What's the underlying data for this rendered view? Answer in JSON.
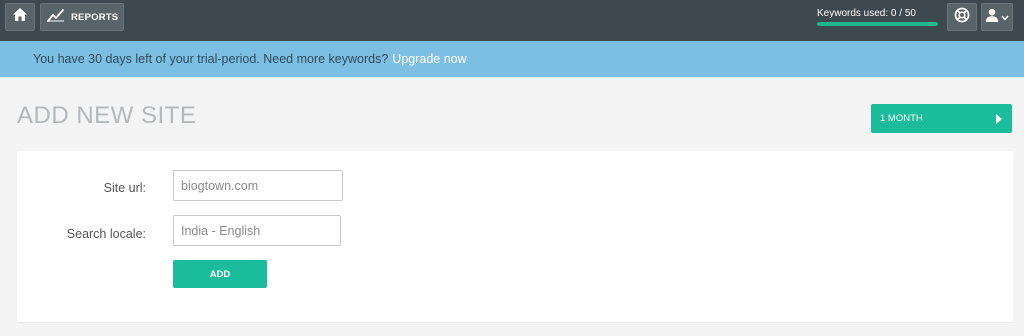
{
  "topbar": {
    "home_icon": "home-icon",
    "reports_icon": "chart-line-icon",
    "reports_label": "REPORTS",
    "keywords_label": "Keywords used: 0 / 50",
    "keywords_used": 0,
    "keywords_total": 50,
    "help_icon": "lifebuoy-icon",
    "user_icon": "user-icon"
  },
  "banner": {
    "message": "You have 30 days left of your trial-period. Need more keywords?",
    "link": "Upgrade now"
  },
  "page": {
    "title": "ADD NEW SITE",
    "period_button": "1 MONTH"
  },
  "form": {
    "site_url_label": "Site url:",
    "site_url_value": "biogtown.com",
    "search_locale_label": "Search locale:",
    "search_locale_value": "India - English",
    "add_button": "ADD"
  },
  "colors": {
    "topbar": "#3d4850",
    "banner": "#7cbfe3",
    "accent": "#1abc9c"
  }
}
